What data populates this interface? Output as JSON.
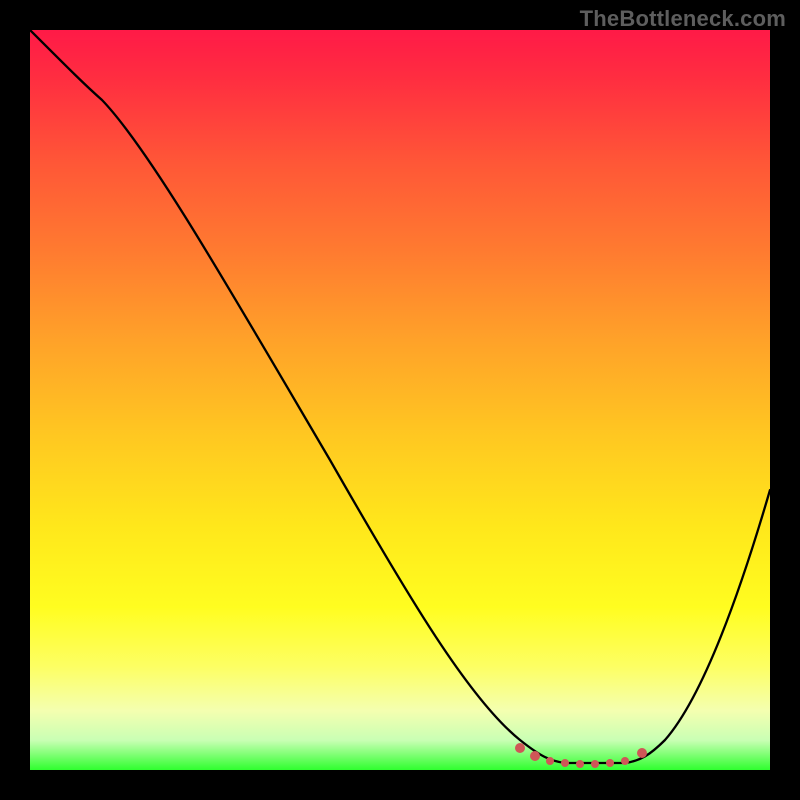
{
  "watermark": "TheBottleneck.com",
  "colors": {
    "background": "#000000",
    "curve": "#000000",
    "dots": "#cf5757",
    "gradient_top": "#ff1a47",
    "gradient_bottom": "#2fff2f"
  },
  "chart_data": {
    "type": "line",
    "title": "",
    "xlabel": "",
    "ylabel": "",
    "xlim": [
      0,
      100
    ],
    "ylim": [
      0,
      100
    ],
    "x": [
      0,
      5,
      10,
      20,
      30,
      40,
      50,
      60,
      65,
      68,
      70,
      72,
      74,
      76,
      78,
      80,
      82,
      85,
      90,
      95,
      100
    ],
    "values": [
      100,
      95,
      90,
      75,
      60,
      45,
      30,
      14,
      6,
      2,
      1,
      0.5,
      0.5,
      0.5,
      0.5,
      0.5,
      1,
      3,
      12,
      24,
      38
    ],
    "series": [
      {
        "name": "bottleneck-curve",
        "x": [
          0,
          5,
          10,
          20,
          30,
          40,
          50,
          60,
          65,
          68,
          70,
          72,
          74,
          76,
          78,
          80,
          82,
          85,
          90,
          95,
          100
        ],
        "values": [
          100,
          95,
          90,
          75,
          60,
          45,
          30,
          14,
          6,
          2,
          1,
          0.5,
          0.5,
          0.5,
          0.5,
          0.5,
          1,
          3,
          12,
          24,
          38
        ]
      },
      {
        "name": "optimal-range-markers",
        "x": [
          66,
          68,
          70,
          72,
          74,
          76,
          78,
          80,
          82
        ],
        "values": [
          2,
          1.2,
          0.8,
          0.6,
          0.6,
          0.6,
          0.6,
          0.8,
          1.5
        ]
      }
    ],
    "annotations": []
  }
}
